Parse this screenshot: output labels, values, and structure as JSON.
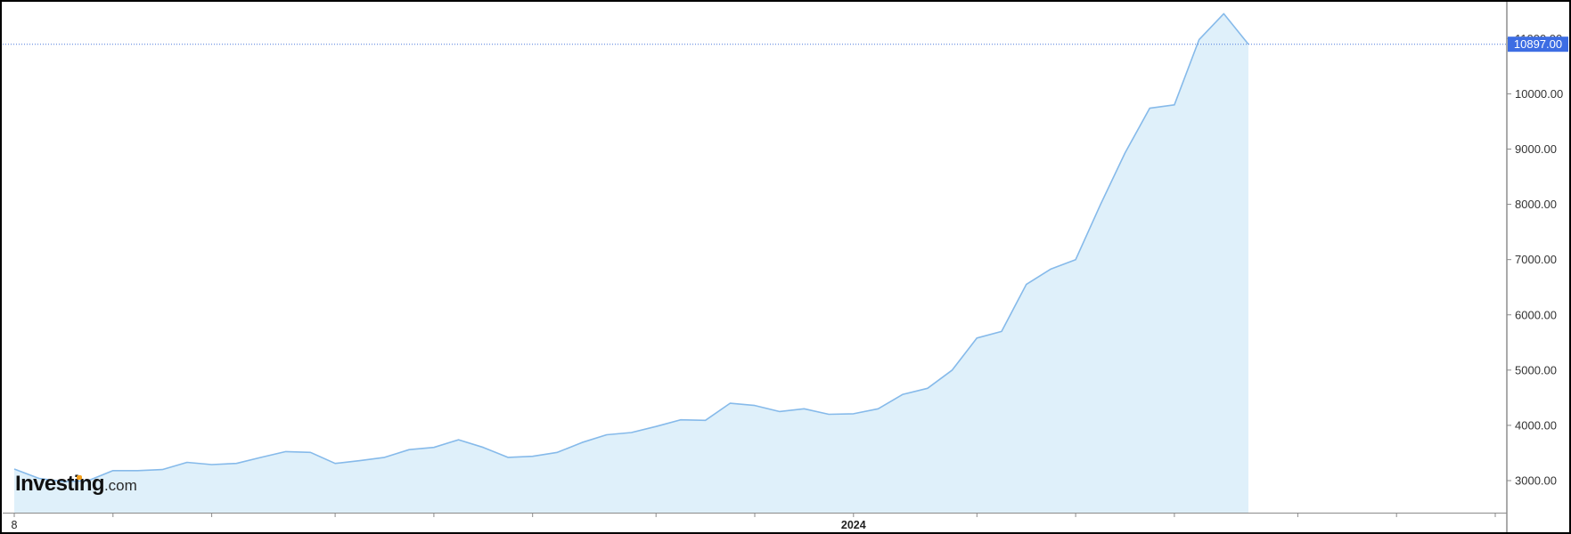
{
  "brand": {
    "name": "Investing",
    "suffix": ".com"
  },
  "colors": {
    "line": "#86baea",
    "fill": "#dff0fa",
    "price_tag": "#3d6de3",
    "price_tag_text": "#ffffff",
    "last_price_line": "#4a78dc",
    "axis_text": "#333333",
    "axis_line": "#8a8a8a",
    "logo_accent": "#f4a01c"
  },
  "chart_data": {
    "type": "area",
    "values": [
      3210,
      3040,
      2980,
      3000,
      3180,
      3180,
      3200,
      3330,
      3290,
      3310,
      3420,
      3525,
      3510,
      3310,
      3360,
      3420,
      3560,
      3600,
      3740,
      3600,
      3420,
      3440,
      3510,
      3690,
      3830,
      3870,
      3980,
      4100,
      4090,
      4400,
      4360,
      4250,
      4300,
      4200,
      4210,
      4300,
      4560,
      4670,
      5000,
      5580,
      5700,
      6550,
      6830,
      7000,
      7990,
      8930,
      9740,
      9800,
      10980,
      11450,
      10897
    ],
    "x_tick_labels": [
      "8",
      "",
      "",
      "",
      "",
      "",
      "",
      "",
      "2024",
      "",
      "",
      "",
      "",
      "",
      ""
    ],
    "y_ticks": [
      "3000.00",
      "4000.00",
      "5000.00",
      "6000.00",
      "7000.00",
      "8000.00",
      "9000.00",
      "10000.00",
      "11000.00"
    ],
    "ylim": [
      2420,
      11650
    ],
    "last_value": "10897.00",
    "y_axis_position": "right",
    "grid": false,
    "legend": "none"
  }
}
